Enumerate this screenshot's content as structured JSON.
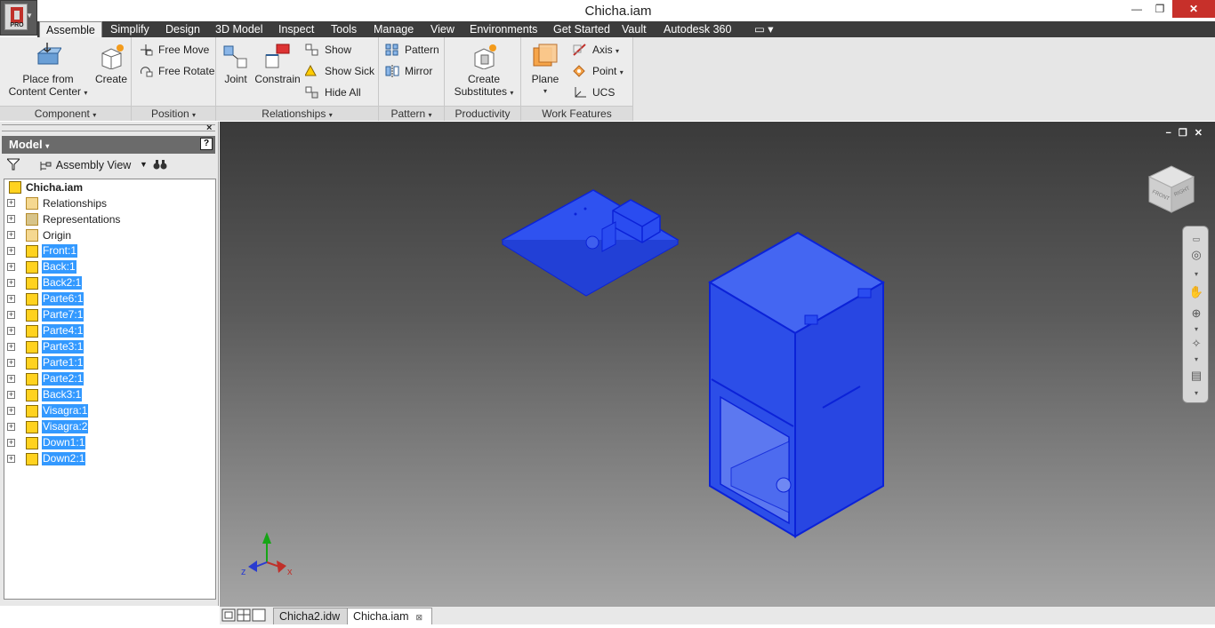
{
  "window": {
    "title": "Chicha.iam",
    "app_badge": "PRO",
    "controls": {
      "minimize": "—",
      "maximize": "❐",
      "close": "✕"
    }
  },
  "ribbon_tabs": [
    {
      "label": "Assemble",
      "active": true
    },
    {
      "label": "Simplify"
    },
    {
      "label": "Design"
    },
    {
      "label": "3D Model"
    },
    {
      "label": "Inspect"
    },
    {
      "label": "Tools"
    },
    {
      "label": "Manage"
    },
    {
      "label": "View"
    },
    {
      "label": "Environments"
    },
    {
      "label": "Get Started"
    },
    {
      "label": "Vault"
    },
    {
      "label": "Autodesk 360"
    }
  ],
  "ribbon": {
    "component": {
      "title": "Component",
      "place_line1": "Place from",
      "place_line2": "Content Center",
      "create": "Create"
    },
    "position": {
      "title": "Position",
      "free_move": "Free Move",
      "free_rotate": "Free Rotate"
    },
    "relationships": {
      "title": "Relationships",
      "joint": "Joint",
      "constrain": "Constrain",
      "show": "Show",
      "show_sick": "Show Sick",
      "hide_all": "Hide All"
    },
    "pattern": {
      "title": "Pattern",
      "pattern": "Pattern",
      "mirror": "Mirror"
    },
    "productivity": {
      "title": "Productivity",
      "create_line1": "Create",
      "create_line2": "Substitutes"
    },
    "work_features": {
      "title": "Work Features",
      "plane": "Plane",
      "axis": "Axis",
      "point": "Point",
      "ucs": "UCS"
    }
  },
  "browser": {
    "header": "Model",
    "help": "?",
    "view_name": "Assembly View",
    "tree": [
      {
        "label": "Chicha.iam",
        "type": "root"
      },
      {
        "label": "Relationships",
        "type": "folder"
      },
      {
        "label": "Representations",
        "type": "reps"
      },
      {
        "label": "Origin",
        "type": "folder"
      },
      {
        "label": "Front:1",
        "type": "part",
        "selected": true
      },
      {
        "label": "Back:1",
        "type": "part",
        "selected": true
      },
      {
        "label": "Back2:1",
        "type": "part",
        "selected": true
      },
      {
        "label": "Parte6:1",
        "type": "part",
        "selected": true
      },
      {
        "label": "Parte7:1",
        "type": "part",
        "selected": true
      },
      {
        "label": "Parte4:1",
        "type": "part",
        "selected": true
      },
      {
        "label": "Parte3:1",
        "type": "part",
        "selected": true
      },
      {
        "label": "Parte1:1",
        "type": "part",
        "selected": true
      },
      {
        "label": "Parte2:1",
        "type": "part",
        "selected": true
      },
      {
        "label": "Back3:1",
        "type": "part",
        "selected": true
      },
      {
        "label": "Visagra:1",
        "type": "part",
        "selected": true
      },
      {
        "label": "Visagra:2",
        "type": "part",
        "selected": true
      },
      {
        "label": "Down1:1",
        "type": "part",
        "selected": true
      },
      {
        "label": "Down2:1",
        "type": "part",
        "selected": true
      }
    ]
  },
  "viewport": {
    "viewcube_front": "FRONT",
    "viewcube_right": "RIGHT",
    "axis_x": "x",
    "axis_z": "z",
    "selection_color": "#2b4ff5",
    "edge_color": "#0b22d8"
  },
  "doc_tabs": [
    {
      "label": "Chicha2.idw",
      "active": false
    },
    {
      "label": "Chicha.iam",
      "active": true
    }
  ]
}
